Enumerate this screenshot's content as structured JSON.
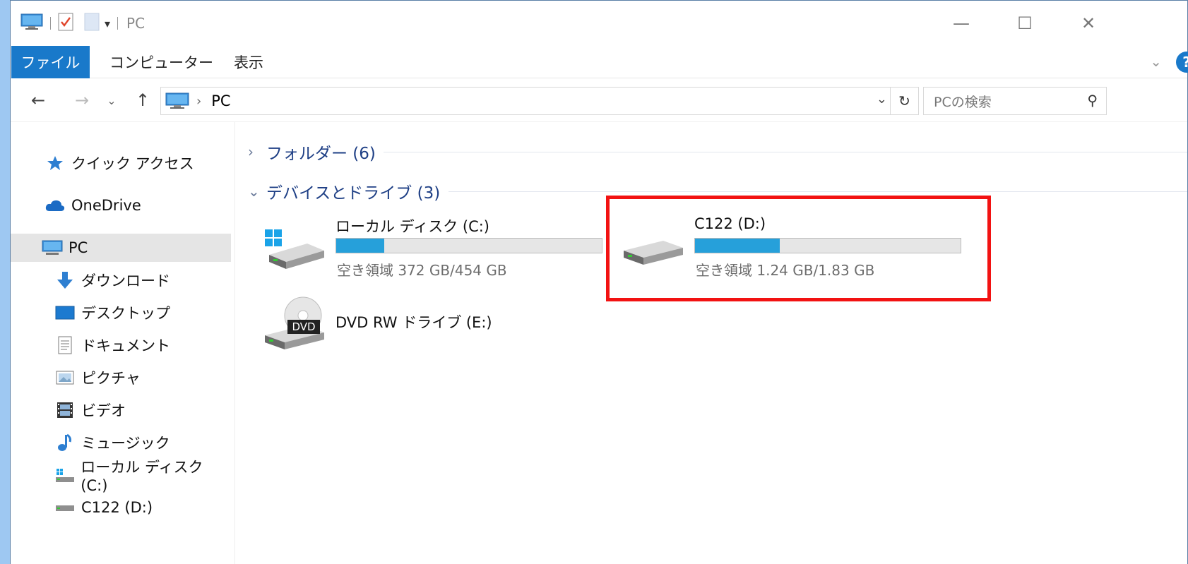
{
  "titlebar": {
    "title": "PC",
    "qat_dropdown": "▾",
    "controls": {
      "minimize": "—",
      "maximize": "☐",
      "close": "✕"
    }
  },
  "ribbon": {
    "tabs": [
      {
        "label": "ファイル"
      },
      {
        "label": "コンピューター"
      },
      {
        "label": "表示"
      }
    ],
    "help_label": "?"
  },
  "address": {
    "crumbs": [
      "PC"
    ],
    "separator": "›"
  },
  "search": {
    "placeholder": "PCの検索"
  },
  "sidebar": {
    "items": [
      {
        "label": "クイック アクセス",
        "icon": "star-icon"
      },
      {
        "label": "OneDrive",
        "icon": "cloud-icon"
      },
      {
        "label": "PC",
        "icon": "computer-icon",
        "selected": true
      },
      {
        "label": "ダウンロード",
        "icon": "download-icon"
      },
      {
        "label": "デスクトップ",
        "icon": "desktop-icon"
      },
      {
        "label": "ドキュメント",
        "icon": "document-icon"
      },
      {
        "label": "ピクチャ",
        "icon": "pictures-icon"
      },
      {
        "label": "ビデオ",
        "icon": "video-icon"
      },
      {
        "label": "ミュージック",
        "icon": "music-icon"
      },
      {
        "label": "ローカル ディスク (C:)",
        "icon": "local-disk-icon"
      },
      {
        "label": "C122 (D:)",
        "icon": "drive-icon"
      }
    ]
  },
  "groups": {
    "folders": {
      "label": "フォルダー (6)",
      "expanded": false
    },
    "devices": {
      "label": "デバイスとドライブ (3)",
      "expanded": true
    }
  },
  "drives": [
    {
      "name": "ローカル ディスク (C:)",
      "free_text": "空き領域 372 GB/454 GB",
      "used_fraction": 0.18,
      "icon": "windows-drive-icon"
    },
    {
      "name": "C122 (D:)",
      "free_text": "空き領域 1.24 GB/1.83 GB",
      "used_fraction": 0.32,
      "icon": "drive-icon"
    },
    {
      "name": "DVD RW ドライブ (E:)",
      "icon": "dvd-drive-icon",
      "icon_text": "DVD"
    }
  ],
  "colors": {
    "accent": "#1979ca",
    "bar_fill": "#26a0da",
    "highlight": "#f21212",
    "group_header": "#1e3f85"
  }
}
